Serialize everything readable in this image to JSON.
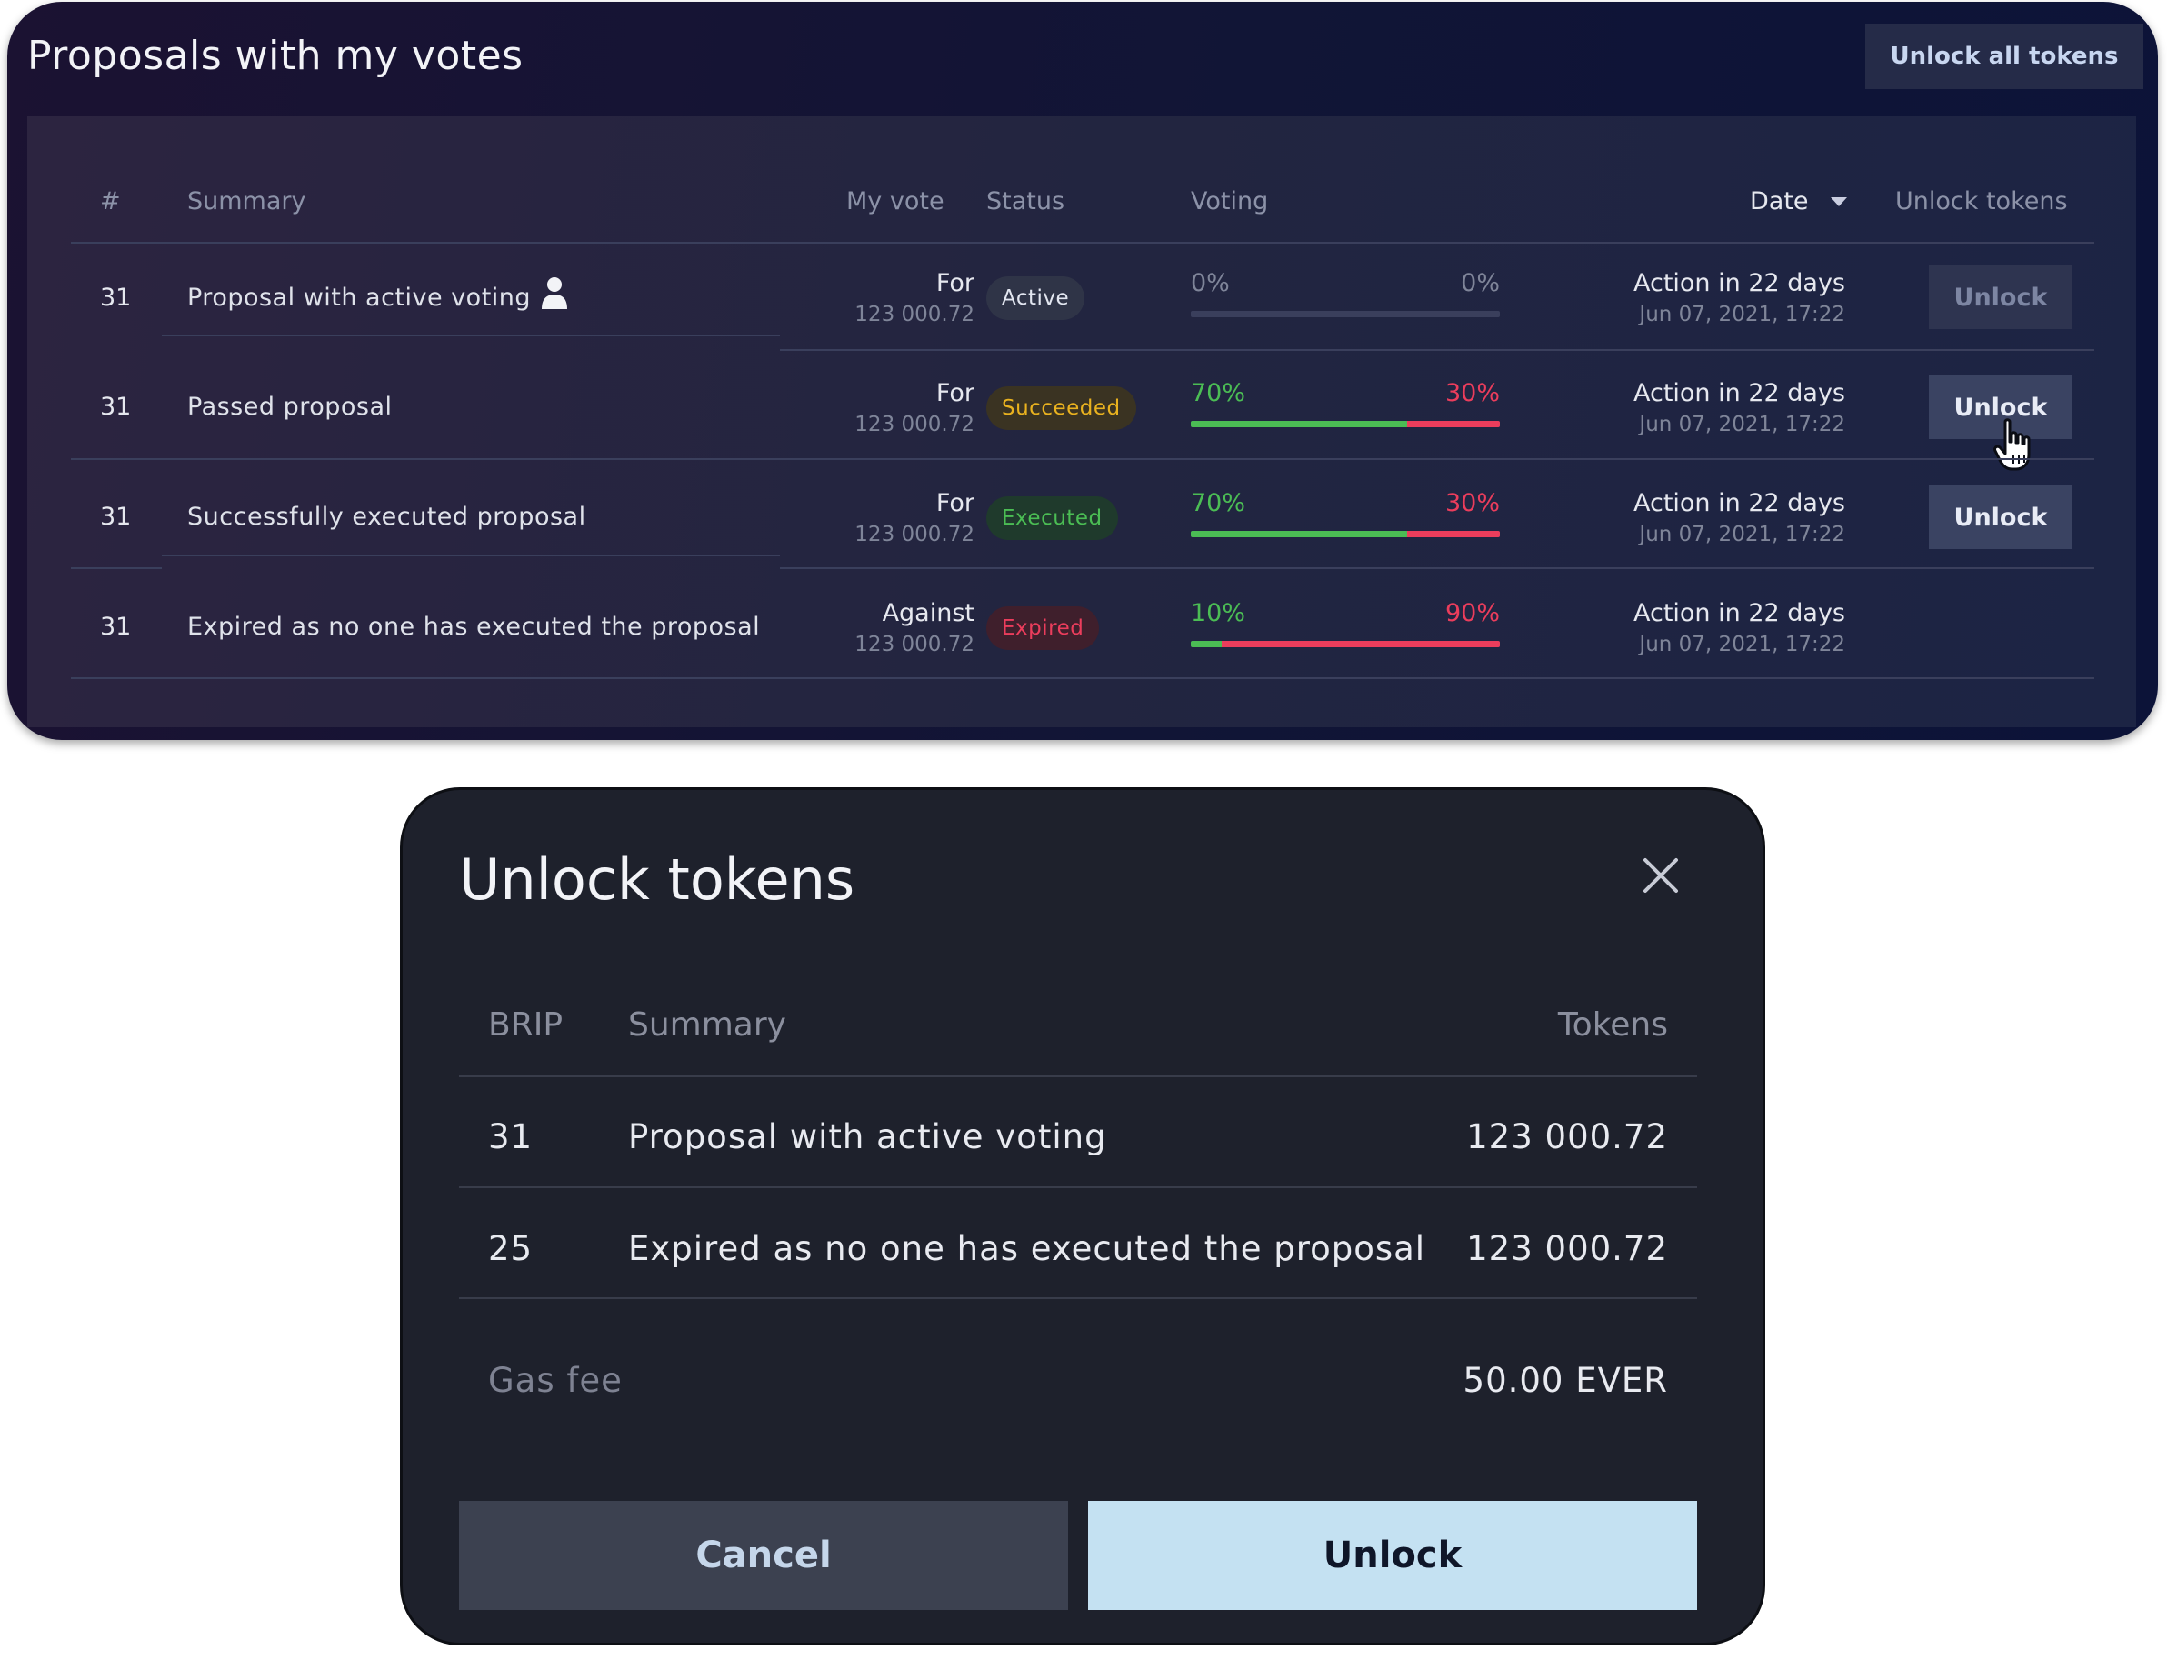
{
  "panel": {
    "title": "Proposals with my votes",
    "unlock_all_label": "Unlock all tokens",
    "headers": {
      "num": "#",
      "summary": "Summary",
      "my_vote": "My vote",
      "status": "Status",
      "voting": "Voting",
      "date": "Date",
      "unlock_tokens": "Unlock tokens"
    },
    "rows": [
      {
        "id": "31",
        "summary": "Proposal with active voting",
        "vote": "For",
        "amount": "123 000.72",
        "status": "Active",
        "for_pct": "0%",
        "against_pct": "0%",
        "for_share": 0,
        "against_share": 0,
        "action": "Action in 22 days",
        "date": "Jun 07, 2021, 17:22",
        "unlock_label": "Unlock",
        "unlock_enabled": false
      },
      {
        "id": "31",
        "summary": "Passed proposal",
        "vote": "For",
        "amount": "123 000.72",
        "status": "Succeeded",
        "for_pct": "70%",
        "against_pct": "30%",
        "for_share": 70,
        "against_share": 30,
        "action": "Action in 22 days",
        "date": "Jun 07, 2021, 17:22",
        "unlock_label": "Unlock",
        "unlock_enabled": true
      },
      {
        "id": "31",
        "summary": "Successfully executed proposal",
        "vote": "For",
        "amount": "123 000.72",
        "status": "Executed",
        "for_pct": "70%",
        "against_pct": "30%",
        "for_share": 70,
        "against_share": 30,
        "action": "Action in 22 days",
        "date": "Jun 07, 2021, 17:22",
        "unlock_label": "Unlock",
        "unlock_enabled": true
      },
      {
        "id": "31",
        "summary": "Expired as no one has executed the proposal",
        "vote": "Against",
        "amount": "123 000.72",
        "status": "Expired",
        "for_pct": "10%",
        "against_pct": "90%",
        "for_share": 10,
        "against_share": 90,
        "action": "Action in 22 days",
        "date": "Jun 07, 2021, 17:22"
      }
    ]
  },
  "modal": {
    "title": "Unlock tokens",
    "headers": {
      "brip": "BRIP",
      "summary": "Summary",
      "tokens": "Tokens"
    },
    "rows": [
      {
        "brip": "31",
        "summary": "Proposal with active voting",
        "tokens": "123 000.72"
      },
      {
        "brip": "25",
        "summary": "Expired as no one has executed the proposal",
        "tokens": "123 000.72"
      }
    ],
    "gas_fee_label": "Gas fee",
    "gas_fee_value": "50.00 EVER",
    "cancel_label": "Cancel",
    "unlock_label": "Unlock"
  },
  "colors": {
    "active": "#e2e6f0",
    "succeeded": "#e9b21f",
    "executed": "#4bbd54",
    "expired": "#eb3d5c",
    "for": "#4bbd54",
    "against": "#eb3d5c"
  },
  "icons": {
    "author": "person-icon",
    "sort": "caret-down-icon",
    "cursor": "hand-pointer-icon",
    "close": "close-icon"
  }
}
